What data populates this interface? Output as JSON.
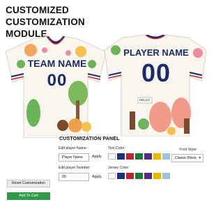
{
  "header": {
    "line1": "CUSTOMIZED",
    "line2": "CUSTOMIZATION",
    "line3": "MODULE"
  },
  "jersey": {
    "front_team_name": "TEAM NAME",
    "front_number": "00",
    "back_player_name": "PLAYER NAME",
    "back_number": "00",
    "hello_text": "HELLO",
    "colors": {
      "navy": "#1b2a6b",
      "red": "#c8202f",
      "base": "#f8f6ee"
    }
  },
  "panel": {
    "title": "CUSTOMIZATION PANEL",
    "player_name_label": "Edit player Name:",
    "player_name_value": "Player Name",
    "player_number_label": "Edit player Number:",
    "player_number_value": "00",
    "apply_label": "Apply",
    "text_color_label": "Text Color:",
    "jersey_color_label": "Jersey Color:",
    "font_style_label": "Font Style:",
    "font_style_value": "Classic Block",
    "swatches": [
      "#ffffff",
      "#1f2e7a",
      "#c8202f",
      "#1f7a3a",
      "#5a2a82",
      "#e6b800",
      "#9cc3e6"
    ]
  },
  "buttons": {
    "reset": "Reset Customization",
    "cart": "Add To Cart"
  }
}
